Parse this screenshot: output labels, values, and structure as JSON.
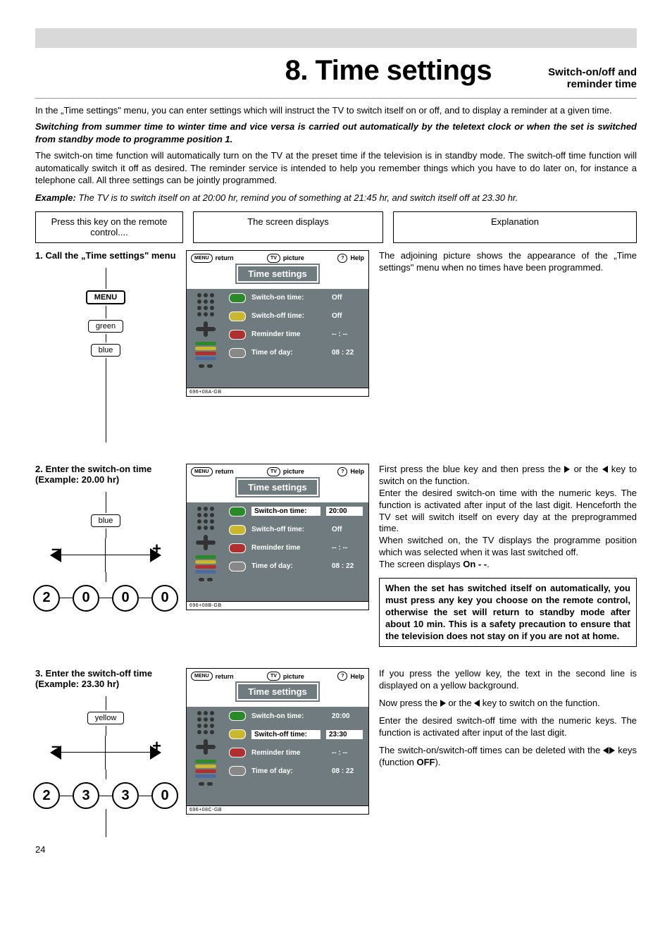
{
  "page_number": "24",
  "chapter_title": "8. Time settings",
  "subtitle_line1": "Switch-on/off and",
  "subtitle_line2": "reminder time",
  "intro_1": "In the „Time settings\" menu, you can enter settings which will instruct the TV to switch itself on or off, and to display a reminder at a given time.",
  "intro_2": "Switching from summer time to winter time and vice versa is carried out automatically by the teletext clock or when the set is switched from standby mode to programme position 1.",
  "intro_3": "The switch-on time function will automatically turn on the TV at the preset time if the television is in standby mode. The switch-off time function will automatically switch it off as desired. The reminder service is intended to help you remember things which you have to do later on, for instance a telephone call. All three settings can be jointly programmed.",
  "example_label": "Example:",
  "example_text": " The TV is to switch itself on at 20:00 hr, remind you of something at 21:45 hr, and switch itself off at 23.30 hr.",
  "header_remote": "Press this key on the remote control....",
  "header_screen": "The screen displays",
  "header_expl": "Explanation",
  "steps": {
    "s1": {
      "title": "1. Call the „Time settings\" menu",
      "keys": {
        "menu": "MENU",
        "green": "green",
        "blue": "blue"
      },
      "osd_code": "696+08A-GB",
      "expl": "The adjoining picture shows the appearance of the „Time settings\" menu when no times have been programmed.",
      "rows": {
        "on": {
          "label": "Switch-on time:",
          "val": "Off",
          "selected": false
        },
        "off": {
          "label": "Switch-off time:",
          "val": "Off",
          "selected": false
        },
        "rem": {
          "label": "Reminder time",
          "val": "-- : --",
          "selected": false
        },
        "tod": {
          "label": "Time of day:",
          "val": "08 : 22",
          "selected": false
        }
      }
    },
    "s2": {
      "title": "2. Enter the switch-on time (Example: 20.00 hr)",
      "keys": {
        "blue": "blue",
        "digits": [
          "2",
          "0",
          "0",
          "0"
        ]
      },
      "osd_code": "696+08B-GB",
      "expl_p1": "First press the blue key and then press the ",
      "expl_p2": " or the ",
      "expl_p3": " key to switch on the function.",
      "expl_p4": "Enter the desired switch-on time with the numeric keys. The function is activated after input of the last digit. Henceforth the TV set will switch itself on every day at the preprogrammed time.",
      "expl_p5": "When switched on, the TV displays the programme position which was selected when it was last switched off.",
      "expl_p6a": "The screen displays ",
      "expl_p6b": "On - -",
      "expl_p6c": ".",
      "note": "When the set has switched itself on automatically, you must press any key you choose on the remote control, otherwise the set will return to standby mode after about 10 min. This is a safety precaution to ensure that the television does not stay on if you are not at home.",
      "rows": {
        "on": {
          "label": "Switch-on time:",
          "val": "20:00",
          "selected": true
        },
        "off": {
          "label": "Switch-off time:",
          "val": "Off",
          "selected": false
        },
        "rem": {
          "label": "Reminder time",
          "val": "-- : --",
          "selected": false
        },
        "tod": {
          "label": "Time of day:",
          "val": "08 : 22",
          "selected": false
        }
      }
    },
    "s3": {
      "title": "3. Enter the switch-off time (Example: 23.30 hr)",
      "keys": {
        "yellow": "yellow",
        "digits": [
          "2",
          "3",
          "3",
          "0"
        ]
      },
      "osd_code": "696+08C-GB",
      "expl_p1": "If you press the yellow key, the text in the second line is displayed on a yellow background.",
      "expl_p2a": "Now press the ",
      "expl_p2b": " or the ",
      "expl_p2c": " key to switch on the function.",
      "expl_p3": "Enter the desired switch-off time with the numeric keys. The function is activated after input of the last digit.",
      "expl_p4a": "The switch-on/switch-off times can be deleted with the ",
      "expl_p4b": " keys (function ",
      "expl_p4c": "OFF",
      "expl_p4d": ").",
      "rows": {
        "on": {
          "label": "Switch-on time:",
          "val": "20:00",
          "selected": false
        },
        "off": {
          "label": "Switch-off time:",
          "val": "23:30",
          "selected": true
        },
        "rem": {
          "label": "Reminder time",
          "val": "-- : --",
          "selected": false
        },
        "tod": {
          "label": "Time of day:",
          "val": "08 : 22",
          "selected": false
        }
      }
    }
  },
  "osd_common": {
    "title": "Time settings",
    "top_return": "return",
    "top_return_btn": "MENU",
    "top_picture": "picture",
    "top_picture_btn": "TV",
    "top_help": "Help",
    "top_help_btn": "?"
  }
}
